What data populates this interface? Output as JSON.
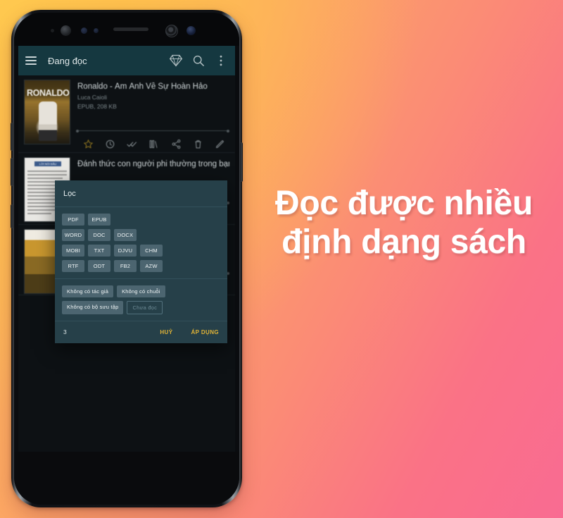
{
  "promo": {
    "headline": "Đọc được nhiều\nđịnh dạng sách",
    "headline_color": "#FFFFFF",
    "background_gradient_from": "#FDBE55",
    "background_gradient_to": "#F96B92"
  },
  "app": {
    "appbar": {
      "menu_icon": "hamburger-menu-icon",
      "title": "Đang đọc",
      "actions": [
        {
          "icon": "diamond-icon",
          "name": "premium-diamond-icon"
        },
        {
          "icon": "search-icon",
          "name": "search-icon"
        },
        {
          "icon": "overflow-icon",
          "name": "overflow-menu-icon"
        }
      ],
      "bar_color": "#153840"
    },
    "books": [
      {
        "title": "Ronaldo - Ám Ảnh Về Sự Hoàn Hảo",
        "author": "Luca Caioli",
        "format": "EPUB, 208 KB",
        "cover_text": "RONALDO",
        "actions": [
          {
            "name": "favorite-star-icon",
            "label": "star"
          },
          {
            "name": "history-clock-icon",
            "label": "clock"
          },
          {
            "name": "mark-read-double-check-icon",
            "label": "double-check"
          },
          {
            "name": "collections-icon",
            "label": "collections"
          },
          {
            "name": "share-icon",
            "label": "share"
          },
          {
            "name": "delete-trash-icon",
            "label": "trash"
          },
          {
            "name": "edit-pencil-icon",
            "label": "pencil"
          }
        ]
      },
      {
        "title": "Đánh thức con người phi thường trong bạn",
        "author": "",
        "format": "",
        "cover_text": "LỜI NÓI ĐẦU"
      },
      {
        "title": "",
        "author": "",
        "format": "",
        "cover_text": ""
      }
    ]
  },
  "filter_dialog": {
    "title": "Lọc",
    "format_rows": [
      [
        "PDF",
        "EPUB"
      ],
      [
        "WORD",
        "DOC",
        "DOCX"
      ],
      [
        "MOBI",
        "TXT",
        "DJVU",
        "CHM"
      ],
      [
        "RTF",
        "ODT",
        "FB2",
        "AZW"
      ]
    ],
    "attribute_rows": [
      [
        {
          "label": "Không có tác giả",
          "selected": true
        },
        {
          "label": "Không có chuỗi",
          "selected": true
        }
      ],
      [
        {
          "label": "Không có bộ sưu tập",
          "selected": true
        },
        {
          "label": "Chưa đọc",
          "selected": false
        }
      ]
    ],
    "count": "3",
    "cancel_label": "HUỶ",
    "apply_label": "ÁP DỤNG",
    "accent_color": "#E0B336",
    "surface_color": "#264049"
  }
}
